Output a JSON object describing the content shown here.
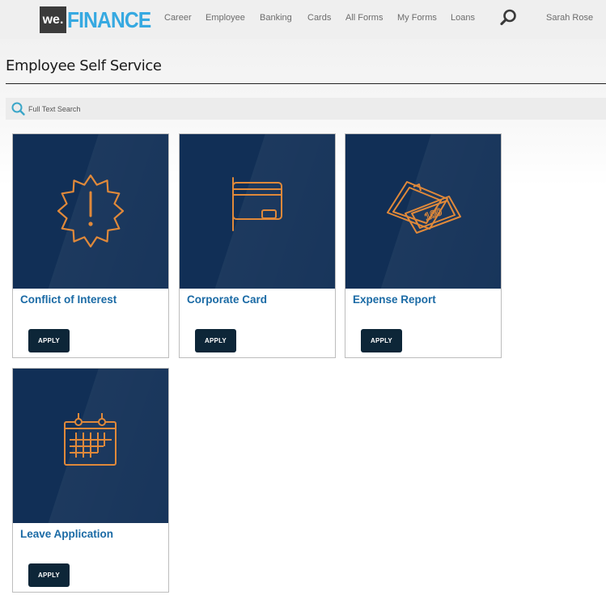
{
  "brand": {
    "prefix": "we.",
    "name": "FINANCE",
    "accent_color": "#36a9e1"
  },
  "nav": {
    "items": [
      {
        "label": "Career"
      },
      {
        "label": "Employee"
      },
      {
        "label": "Banking"
      },
      {
        "label": "Cards"
      },
      {
        "label": "All Forms"
      },
      {
        "label": "My Forms"
      },
      {
        "label": "Loans"
      }
    ],
    "search_icon": "search-icon",
    "user_name": "Sarah Rose"
  },
  "page": {
    "title": "Employee Self Service"
  },
  "search": {
    "placeholder": "Full Text Search"
  },
  "cards": [
    {
      "title": "Conflict of Interest",
      "icon": "alert-badge-icon",
      "button": "APPLY"
    },
    {
      "title": "Corporate Card",
      "icon": "credit-card-icon",
      "button": "APPLY"
    },
    {
      "title": "Expense Report",
      "icon": "money-bills-icon",
      "button": "APPLY"
    },
    {
      "title": "Leave Application",
      "icon": "calendar-icon",
      "button": "APPLY"
    }
  ],
  "colors": {
    "card_background": "#112f56",
    "icon_stroke": "#e0893a",
    "title_link": "#1a6aa5",
    "button_background": "#0d2638"
  }
}
